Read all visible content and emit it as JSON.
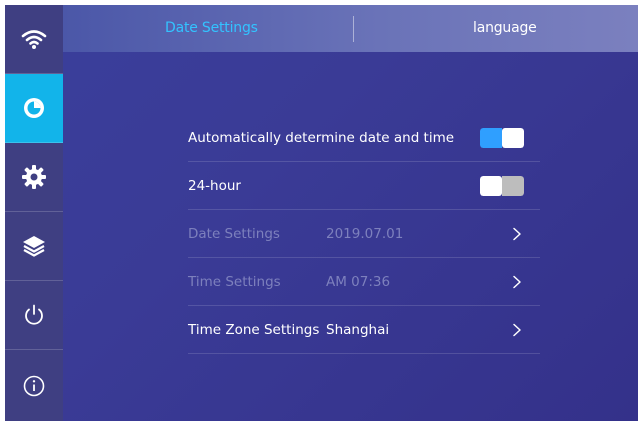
{
  "sidebar": {
    "items": [
      {
        "icon": "wifi-icon",
        "active": false
      },
      {
        "icon": "clock-icon",
        "active": true
      },
      {
        "icon": "gear-icon",
        "active": false
      },
      {
        "icon": "layers-icon",
        "active": false
      },
      {
        "icon": "power-icon",
        "active": false
      },
      {
        "icon": "info-icon",
        "active": false
      }
    ],
    "active_color": "#12b4ea"
  },
  "tabs": {
    "date_settings": "Date Settings",
    "language": "language",
    "active_color": "#33c3ff"
  },
  "settings": {
    "auto_date_time": {
      "label": "Automatically determine date and time",
      "enabled": true
    },
    "hour24": {
      "label": "24-hour",
      "enabled": false
    },
    "date": {
      "label": "Date Settings",
      "value": "2019.07.01",
      "disabled": true
    },
    "time": {
      "label": "Time Settings",
      "value": "AM 07:36",
      "disabled": true
    },
    "timezone": {
      "label": "Time Zone Settings",
      "value": "Shanghai",
      "disabled": false
    }
  },
  "colors": {
    "background": "#3a3b96",
    "toggle_on": "#2f9fff",
    "toggle_off": "#bdbdbd",
    "disabled_text": "#7d80bd"
  }
}
